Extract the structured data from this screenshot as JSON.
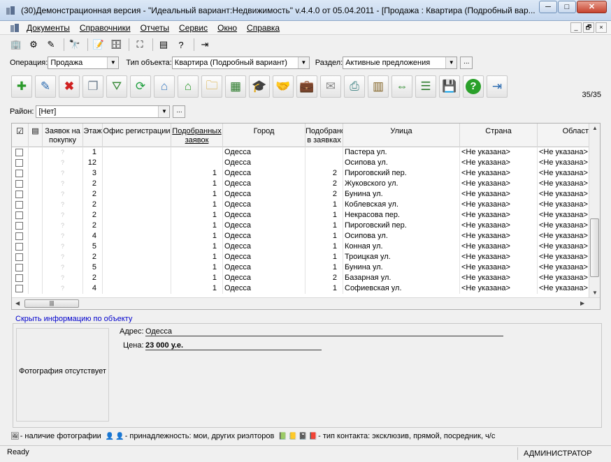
{
  "window": {
    "title": "(30)Демонстрационная версия - \"Идеальный вариант:Недвижимость\" v.4.4.0 от 05.04.2011 - [Продажа : Квартира (Подробный вар...",
    "minimize_label": "─",
    "maximize_label": "□",
    "close_label": "✕"
  },
  "menu": [
    "Документы",
    "Справочники",
    "Отчеты",
    "Сервис",
    "Окно",
    "Справка"
  ],
  "mdi_buttons": [
    "_",
    "🗗",
    "×"
  ],
  "toolbar1_icons": [
    "building-icon",
    "tree-icon",
    "checklist-icon",
    "binoculars-icon",
    "notepad-icon",
    "database-icon",
    "frame-icon",
    "card-icon",
    "help-icon",
    "exit-icon"
  ],
  "filters": {
    "operation_label": "Операция:",
    "operation_value": "Продажа",
    "object_type_label": "Тип объекта:",
    "object_type_value": "Квартира (Подробный вариант)",
    "section_label": "Раздел:",
    "section_value": "Активные предложения",
    "dots": "..."
  },
  "toolbar2_icons": [
    "add-doc-icon",
    "edit-doc-icon",
    "delete-icon",
    "copy-doc-icon",
    "filter-add-icon",
    "refresh-icon",
    "search-house-icon",
    "house-icon",
    "folders-icon",
    "table-icon",
    "graduation-icon",
    "handshake-icon",
    "briefcase-icon",
    "mail-icon",
    "printer-icon",
    "grid-view-icon",
    "columns-icon",
    "report-icon",
    "export-icon",
    "help-icon",
    "exit-icon"
  ],
  "counter": "35/35",
  "district": {
    "label": "Район:",
    "value": "[Нет]"
  },
  "grid": {
    "columns": [
      {
        "key": "chk",
        "label": "☑"
      },
      {
        "key": "mark",
        "label": ""
      },
      {
        "key": "orders",
        "label": "Заявок на покупку"
      },
      {
        "key": "floor",
        "label": "Этаж"
      },
      {
        "key": "office",
        "label": "Офис регистрации"
      },
      {
        "key": "matched",
        "label": "Подобранных заявок"
      },
      {
        "key": "city",
        "label": "Город"
      },
      {
        "key": "matched_in",
        "label": "Подобрано в заявках"
      },
      {
        "key": "street",
        "label": "Улица"
      },
      {
        "key": "country",
        "label": "Страна"
      },
      {
        "key": "region",
        "label": "Област"
      }
    ],
    "rows": [
      {
        "orders": "?",
        "floor": "1",
        "matched": "",
        "city": "Одесса",
        "matched_in": "",
        "street": "Пастера ул.",
        "country": "<Не указана>",
        "region": "<Не указана>"
      },
      {
        "orders": "?",
        "floor": "12",
        "matched": "",
        "city": "Одесса",
        "matched_in": "",
        "street": "Осипова ул.",
        "country": "<Не указана>",
        "region": "<Не указана>"
      },
      {
        "orders": "?",
        "floor": "3",
        "matched": "1",
        "city": "Одесса",
        "matched_in": "2",
        "street": "Пироговский пер.",
        "country": "<Не указана>",
        "region": "<Не указана>"
      },
      {
        "orders": "?",
        "floor": "2",
        "matched": "1",
        "city": "Одесса",
        "matched_in": "2",
        "street": "Жуковского ул.",
        "country": "<Не указана>",
        "region": "<Не указана>"
      },
      {
        "orders": "?",
        "floor": "2",
        "matched": "1",
        "city": "Одесса",
        "matched_in": "2",
        "street": "Бунина ул.",
        "country": "<Не указана>",
        "region": "<Не указана>"
      },
      {
        "orders": "?",
        "floor": "2",
        "matched": "1",
        "city": "Одесса",
        "matched_in": "1",
        "street": "Коблевская ул.",
        "country": "<Не указана>",
        "region": "<Не указана>"
      },
      {
        "orders": "?",
        "floor": "2",
        "matched": "1",
        "city": "Одесса",
        "matched_in": "1",
        "street": "Некрасова пер.",
        "country": "<Не указана>",
        "region": "<Не указана>"
      },
      {
        "orders": "?",
        "floor": "2",
        "matched": "1",
        "city": "Одесса",
        "matched_in": "1",
        "street": "Пироговский пер.",
        "country": "<Не указана>",
        "region": "<Не указана>"
      },
      {
        "orders": "?",
        "floor": "4",
        "matched": "1",
        "city": "Одесса",
        "matched_in": "1",
        "street": "Осипова ул.",
        "country": "<Не указана>",
        "region": "<Не указана>"
      },
      {
        "orders": "?",
        "floor": "5",
        "matched": "1",
        "city": "Одесса",
        "matched_in": "1",
        "street": "Конная ул.",
        "country": "<Не указана>",
        "region": "<Не указана>"
      },
      {
        "orders": "?",
        "floor": "2",
        "matched": "1",
        "city": "Одесса",
        "matched_in": "1",
        "street": "Троицкая ул.",
        "country": "<Не указана>",
        "region": "<Не указана>"
      },
      {
        "orders": "?",
        "floor": "5",
        "matched": "1",
        "city": "Одесса",
        "matched_in": "1",
        "street": "Бунина ул.",
        "country": "<Не указана>",
        "region": "<Не указана>"
      },
      {
        "orders": "?",
        "floor": "2",
        "matched": "1",
        "city": "Одесса",
        "matched_in": "2",
        "street": "Базарная ул.",
        "country": "<Не указана>",
        "region": "<Не указана>"
      },
      {
        "orders": "?",
        "floor": "4",
        "matched": "1",
        "city": "Одесса",
        "matched_in": "1",
        "street": "Софиевская ул.",
        "country": "<Не указана>",
        "region": "<Не указана>"
      }
    ]
  },
  "info": {
    "hide_link": "Скрыть информацию по объекту",
    "photo_text": "Фотография отсутствует",
    "address_label": "Адрес:",
    "address_value": "Одесса",
    "price_label": "Цена:",
    "price_value": "23 000 у.е."
  },
  "legend": {
    "photo": "- наличие фотографии",
    "ownership": "- принадлежность: мои, других риэлторов",
    "contact": "- тип контакта: эксклюзив, прямой, посредник, ч/с"
  },
  "status": {
    "left": "Ready",
    "user": "АДМИНИСТРАТОР"
  }
}
